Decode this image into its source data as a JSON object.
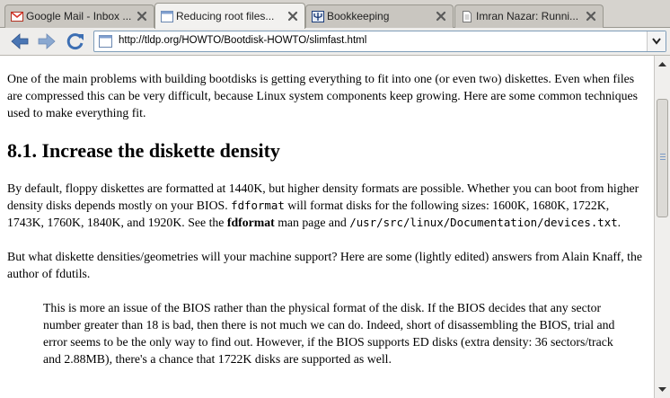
{
  "tabs": [
    {
      "label": "Google Mail - Inbox ...",
      "icon": "gmail-icon",
      "active": false
    },
    {
      "label": "Reducing root files...",
      "icon": "page-icon",
      "active": true
    },
    {
      "label": "Bookkeeping",
      "icon": "trident-icon",
      "active": false
    },
    {
      "label": "Imran Nazar: Runni...",
      "icon": "document-icon",
      "active": false
    }
  ],
  "nav": {
    "back": "back-arrow-icon",
    "forward": "forward-arrow-icon",
    "reload": "reload-icon",
    "url": "http://tldp.org/HOWTO/Bootdisk-HOWTO/slimfast.html"
  },
  "content": {
    "intro": "One of the main problems with building bootdisks is getting everything to fit into one (or even two) diskettes. Even when files are compressed this can be very difficult, because Linux system components keep growing. Here are some common techniques used to make everything fit.",
    "heading": "8.1. Increase the diskette density",
    "p2": {
      "a": "By default, floppy diskettes are formatted at 1440K, but higher density formats are possible. Whether you can boot from higher density disks depends mostly on your BIOS. ",
      "code1": "fdformat",
      "b": " will format disks for the following sizes: 1600K, 1680K, 1722K, 1743K, 1760K, 1840K, and 1920K. See the ",
      "bold": "fdformat",
      "c": " man page and ",
      "code2": "/usr/src/linux/Documentation/devices.txt",
      "d": "."
    },
    "p3": "But what diskette densities/geometries will your machine support? Here are some (lightly edited) answers from Alain Knaff, the author of fdutils.",
    "quote": "This is more an issue of the BIOS rather than the physical format of the disk. If the BIOS decides that any sector number greater than 18 is bad, then there is not much we can do. Indeed, short of disassembling the BIOS, trial and error seems to be the only way to find out. However, if the BIOS supports ED disks (extra density: 36 sectors/track and 2.88MB), there's a chance that 1722K disks are supported as well."
  },
  "colors": {
    "tab_bg": "#c9c6c0",
    "tab_active_bg": "#f2f1ef",
    "close_x": "#5a5a5a",
    "nav_arrow": "#4a76b4"
  }
}
